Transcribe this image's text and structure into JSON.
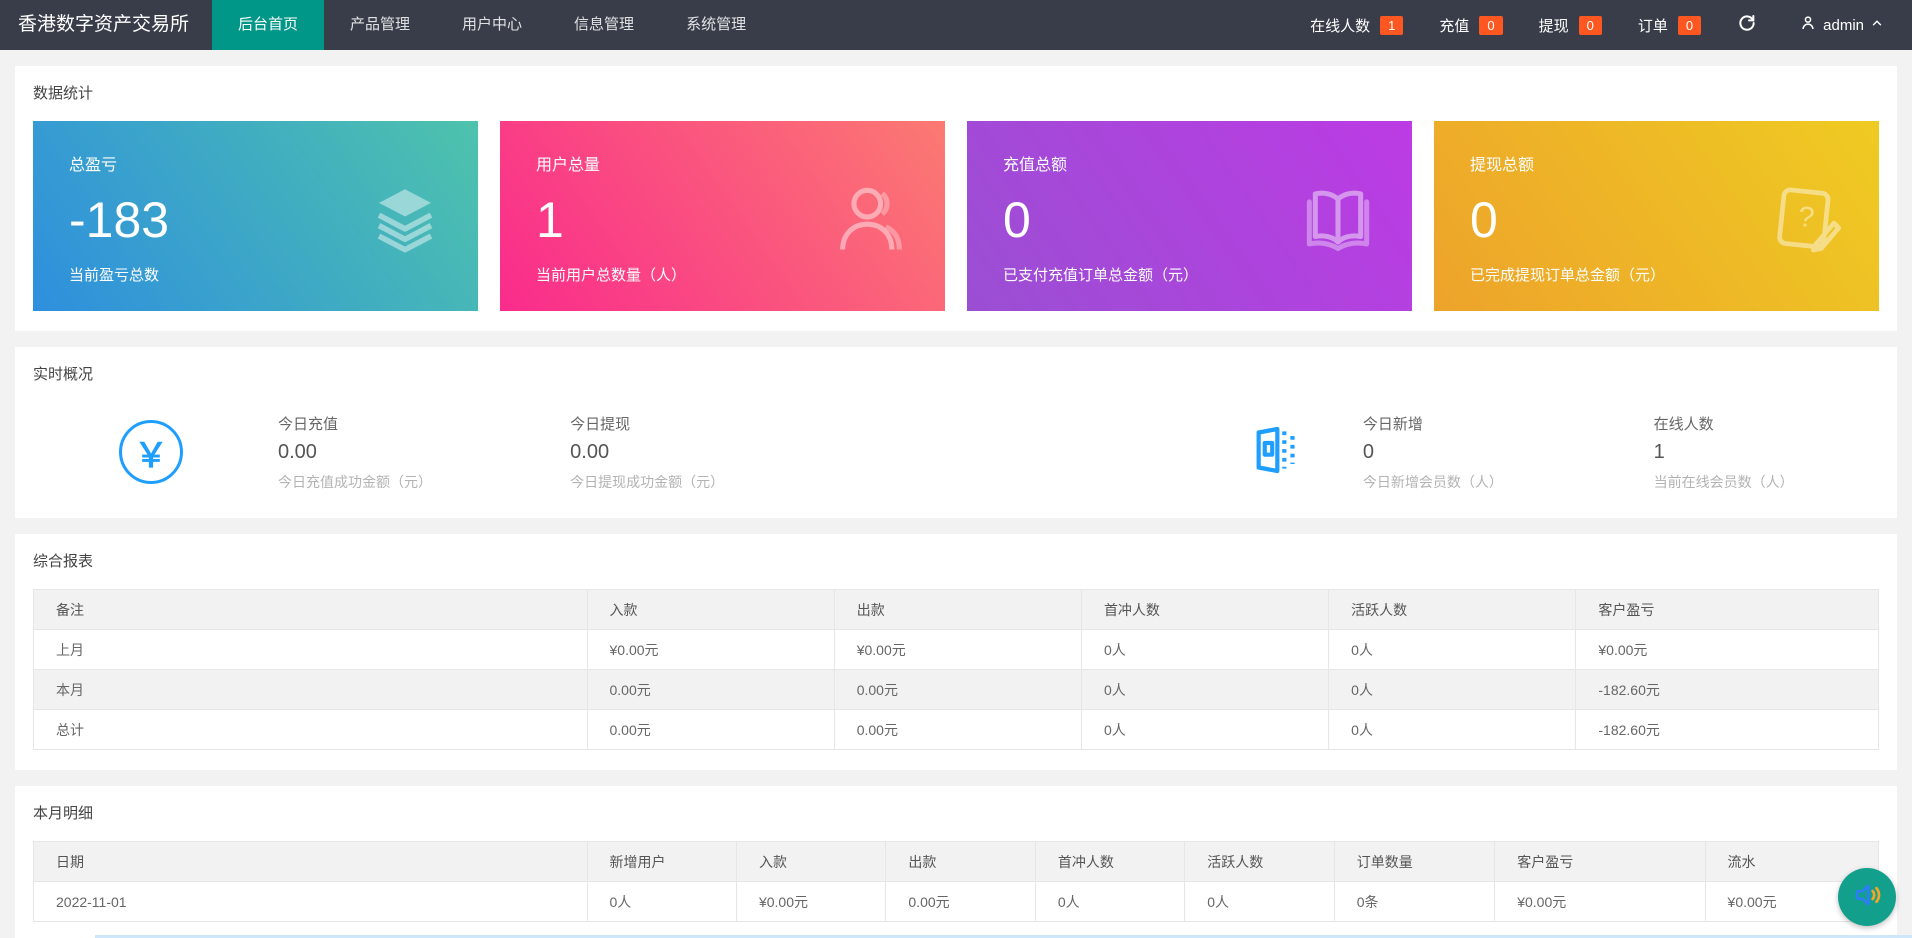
{
  "topbar": {
    "logo": "香港数字资产交易所",
    "menu": [
      {
        "label": "后台首页",
        "active": true
      },
      {
        "label": "产品管理",
        "active": false
      },
      {
        "label": "用户中心",
        "active": false
      },
      {
        "label": "信息管理",
        "active": false
      },
      {
        "label": "系统管理",
        "active": false
      }
    ],
    "stats": [
      {
        "label": "在线人数",
        "count": "1"
      },
      {
        "label": "充值",
        "count": "0"
      },
      {
        "label": "提现",
        "count": "0"
      },
      {
        "label": "订单",
        "count": "0"
      }
    ],
    "user": "admin"
  },
  "colors": {
    "topbar_bg": "#393D49",
    "active_tab": "#009688",
    "badge": "#FF5722",
    "accent_blue": "#1E9FFF",
    "voice_button": "#12A08D",
    "card1_gradient": [
      "#2E8FDE",
      "#4EC3AC"
    ],
    "card2_gradient": [
      "#FA2B8C",
      "#FB7A72"
    ],
    "card3_gradient": [
      "#9A4FD3",
      "#BC3BE4"
    ],
    "card4_gradient": [
      "#EDA32B",
      "#EFCB22"
    ]
  },
  "stats_panel": {
    "title": "数据统计",
    "cards": [
      {
        "title": "总盈亏",
        "value": "-183",
        "subtitle": "当前盈亏总数",
        "icon": "layers-icon"
      },
      {
        "title": "用户总量",
        "value": "1",
        "subtitle": "当前用户总数量（人）",
        "icon": "user-icon"
      },
      {
        "title": "充值总额",
        "value": "0",
        "subtitle": "已支付充值订单总金额（元）",
        "icon": "book-icon"
      },
      {
        "title": "提现总额",
        "value": "0",
        "subtitle": "已完成提现订单总金额（元）",
        "icon": "document-question-icon"
      }
    ]
  },
  "realtime_panel": {
    "title": "实时概况",
    "metrics": [
      {
        "label": "今日充值",
        "value": "0.00",
        "desc": "今日充值成功金额（元）"
      },
      {
        "label": "今日提现",
        "value": "0.00",
        "desc": "今日提现成功金额（元）"
      },
      {
        "label": "今日新增",
        "value": "0",
        "desc": "今日新增会员数（人）"
      },
      {
        "label": "在线人数",
        "value": "1",
        "desc": "当前在线会员数（人）"
      }
    ]
  },
  "report_panel": {
    "title": "综合报表",
    "headers": [
      "备注",
      "入款",
      "出款",
      "首冲人数",
      "活跃人数",
      "客户盈亏"
    ],
    "rows": [
      [
        "上月",
        "¥0.00元",
        "¥0.00元",
        "0人",
        "0人",
        "¥0.00元"
      ],
      [
        "本月",
        "0.00元",
        "0.00元",
        "0人",
        "0人",
        "-182.60元"
      ],
      [
        "总计",
        "0.00元",
        "0.00元",
        "0人",
        "0人",
        "-182.60元"
      ]
    ]
  },
  "detail_panel": {
    "title": "本月明细",
    "headers": [
      "日期",
      "新增用户",
      "入款",
      "出款",
      "首冲人数",
      "活跃人数",
      "订单数量",
      "客户盈亏",
      "流水"
    ],
    "rows": [
      [
        "2022-11-01",
        "0人",
        "¥0.00元",
        "0.00元",
        "0人",
        "0人",
        "0条",
        "¥0.00元",
        "¥0.00元"
      ]
    ]
  }
}
